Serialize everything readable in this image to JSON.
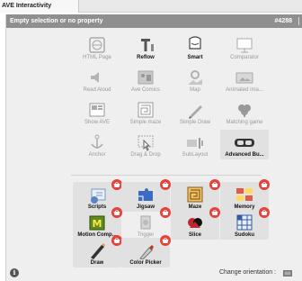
{
  "tab": {
    "label": "AVE Interactivity"
  },
  "header": {
    "title": "Empty selection or no property",
    "object_id": "#4288"
  },
  "tools": [
    {
      "label": "HTML Page",
      "icon": "html-page-icon",
      "active": false
    },
    {
      "label": "Reflow",
      "icon": "reflow-icon",
      "active": true
    },
    {
      "label": "Smart",
      "icon": "smart-icon",
      "active": true
    },
    {
      "label": "Comparator",
      "icon": "comparator-icon",
      "active": false
    },
    {
      "label": "Read Aloud",
      "icon": "read-aloud-icon",
      "active": false
    },
    {
      "label": "Ave Comics",
      "icon": "ave-comics-icon",
      "active": false
    },
    {
      "label": "Map",
      "icon": "map-icon",
      "active": false
    },
    {
      "label": "Animated ima...",
      "icon": "animated-image-icon",
      "active": false
    },
    {
      "label": "Show AVE",
      "icon": "show-ave-icon",
      "active": false
    },
    {
      "label": "Simple maze",
      "icon": "simple-maze-icon",
      "active": false
    },
    {
      "label": "Simple Draw",
      "icon": "simple-draw-icon",
      "active": false
    },
    {
      "label": "Matching game",
      "icon": "matching-game-icon",
      "active": false
    },
    {
      "label": "Anchor",
      "icon": "anchor-icon",
      "active": false
    },
    {
      "label": "Drag & Drop",
      "icon": "drag-drop-icon",
      "active": false
    },
    {
      "label": "SubLayout",
      "icon": "sublayout-icon",
      "active": false
    },
    {
      "label": "Advanced Bu...",
      "icon": "advanced-button-icon",
      "active": true
    }
  ],
  "premium": [
    {
      "label": "Scripts",
      "icon": "scripts-icon",
      "active": true
    },
    {
      "label": "Jigsaw",
      "icon": "jigsaw-icon",
      "active": true
    },
    {
      "label": "Maze",
      "icon": "maze-icon",
      "active": true
    },
    {
      "label": "Memory",
      "icon": "memory-icon",
      "active": true
    },
    {
      "label": "Motion Comp...",
      "icon": "motion-comp-icon",
      "active": true
    },
    {
      "label": "Trigger",
      "icon": "trigger-icon",
      "active": false
    },
    {
      "label": "Slice",
      "icon": "slice-icon",
      "active": true
    },
    {
      "label": "Sudoku",
      "icon": "sudoku-icon",
      "active": true
    },
    {
      "label": "Draw",
      "icon": "draw-icon",
      "active": true
    },
    {
      "label": "Color Picker",
      "icon": "color-picker-icon",
      "active": true
    }
  ],
  "footer": {
    "info": "i",
    "orientation_label": "Change orientation :"
  },
  "colors": {
    "header_bg": "#8f8f8f",
    "panel_bg": "#efefef",
    "badge": "#e3413a"
  }
}
